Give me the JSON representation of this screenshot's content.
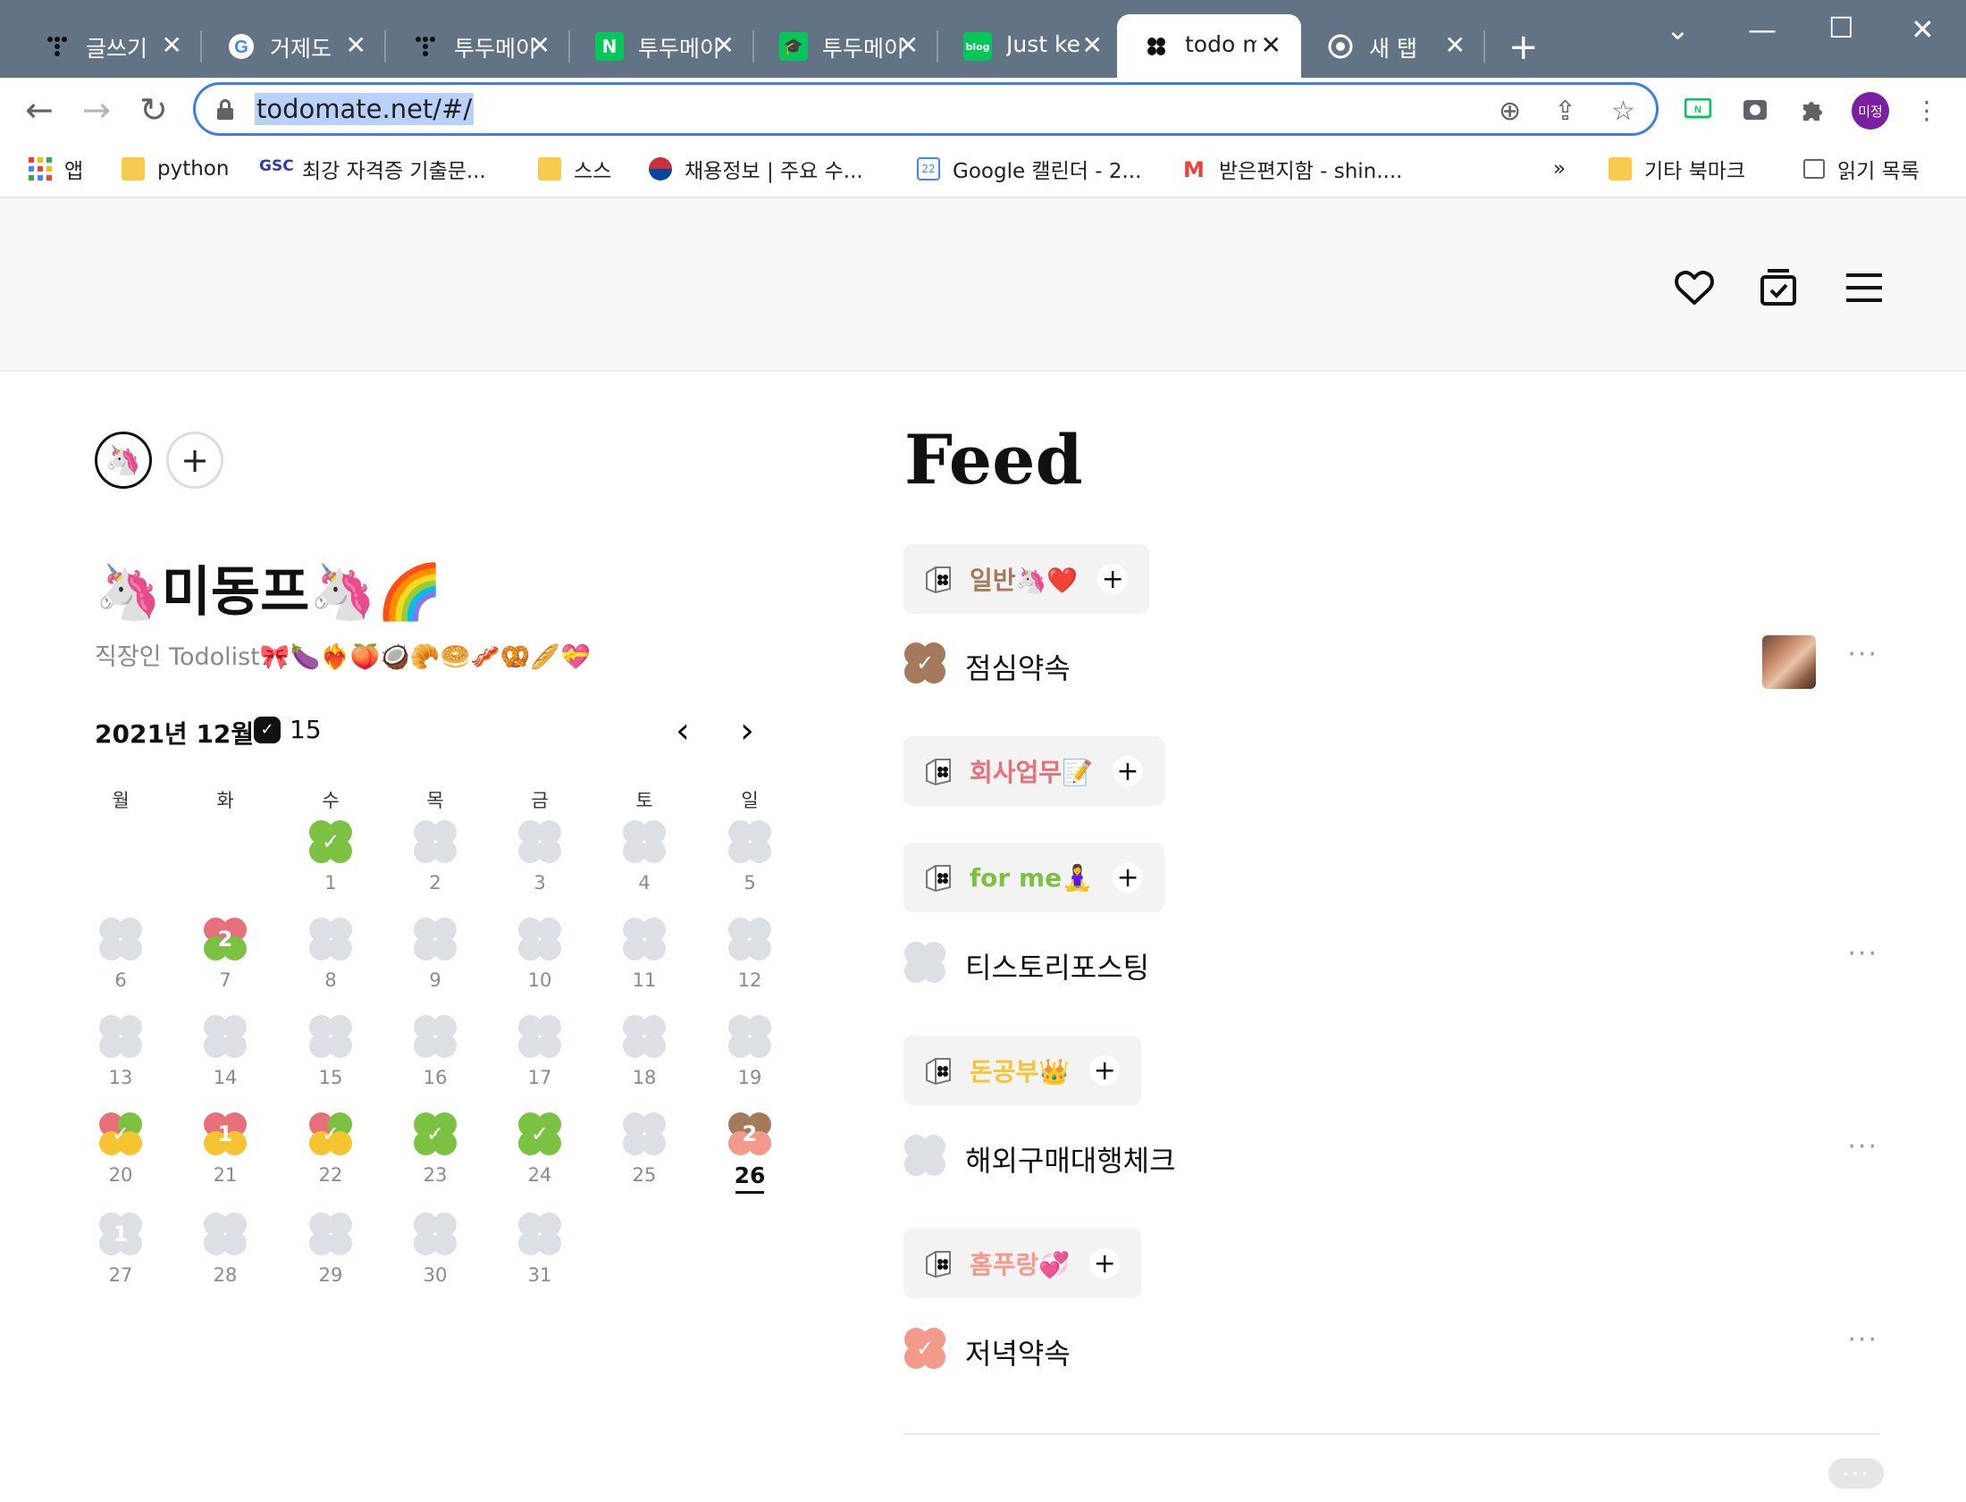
{
  "browser": {
    "tabs": [
      {
        "title": "글쓰기",
        "icon": "tistory-icon"
      },
      {
        "title": "거제도",
        "icon": "google-icon"
      },
      {
        "title": "투두메이",
        "icon": "tistory-icon"
      },
      {
        "title": "투두메이",
        "icon": "naver-icon"
      },
      {
        "title": "투두메이",
        "icon": "graduation-cap-icon"
      },
      {
        "title": "Just ke",
        "icon": "naver-blog-icon"
      },
      {
        "title": "todo m",
        "icon": "todomate-icon"
      },
      {
        "title": "새 탭",
        "icon": "chrome-icon"
      }
    ],
    "new_tab": "+",
    "url": "todomate.net/#/",
    "profile_label": "미정",
    "bookmarks": [
      {
        "label": "앱"
      },
      {
        "label": "python"
      },
      {
        "label": "최강 자격증 기출문..."
      },
      {
        "label": "스스"
      },
      {
        "label": "채용정보 | 주요 수..."
      },
      {
        "label": "Google 캘린더 - 2..."
      },
      {
        "label": "받은편지함 - shin...."
      }
    ],
    "bookmarks_overflow": "»",
    "other_bookmarks": "기타 북마크",
    "reading_list": "읽기 목록"
  },
  "profile": {
    "avatar": "🦄",
    "add": "+",
    "name": "🦄미동프🦄🌈",
    "description": "직장인 Todolist🎀🍆❤️‍🔥🍑🥥🥐🥯🥓🥨🥖💝"
  },
  "calendar": {
    "month_label": "2021년 12월",
    "check_count": "15",
    "prev": "‹",
    "next": "›",
    "weekdays": [
      "월",
      "화",
      "수",
      "목",
      "금",
      "토",
      "일"
    ],
    "days": [
      {
        "d": "1",
        "mark": "✓"
      },
      {
        "d": "2",
        "mark": ""
      },
      {
        "d": "3",
        "mark": ""
      },
      {
        "d": "4",
        "mark": ""
      },
      {
        "d": "5",
        "mark": ""
      },
      {
        "d": "6",
        "mark": ""
      },
      {
        "d": "7",
        "mark": "2"
      },
      {
        "d": "8",
        "mark": ""
      },
      {
        "d": "9",
        "mark": ""
      },
      {
        "d": "10",
        "mark": ""
      },
      {
        "d": "11",
        "mark": ""
      },
      {
        "d": "12",
        "mark": ""
      },
      {
        "d": "13",
        "mark": ""
      },
      {
        "d": "14",
        "mark": ""
      },
      {
        "d": "15",
        "mark": ""
      },
      {
        "d": "16",
        "mark": ""
      },
      {
        "d": "17",
        "mark": ""
      },
      {
        "d": "18",
        "mark": ""
      },
      {
        "d": "19",
        "mark": ""
      },
      {
        "d": "20",
        "mark": "✓"
      },
      {
        "d": "21",
        "mark": "1"
      },
      {
        "d": "22",
        "mark": "✓"
      },
      {
        "d": "23",
        "mark": "✓"
      },
      {
        "d": "24",
        "mark": "✓"
      },
      {
        "d": "25",
        "mark": ""
      },
      {
        "d": "26",
        "mark": "2"
      },
      {
        "d": "27",
        "mark": "1"
      },
      {
        "d": "28",
        "mark": ""
      },
      {
        "d": "29",
        "mark": ""
      },
      {
        "d": "30",
        "mark": ""
      },
      {
        "d": "31",
        "mark": ""
      }
    ]
  },
  "feed": {
    "title": "Feed",
    "categories": [
      {
        "name": "일반🦄❤️",
        "color": "#a57a5a",
        "plus": "+"
      },
      {
        "name": "회사업무📝",
        "color": "#e8707a",
        "plus": "+"
      },
      {
        "name": "for me🧘‍♀️",
        "color": "#7cc242",
        "plus": "+"
      },
      {
        "name": "돈공부👑",
        "color": "#f5c430",
        "plus": "+"
      },
      {
        "name": "홈푸랑💞",
        "color": "#f49a8a",
        "plus": "+"
      }
    ],
    "todos": [
      {
        "text": "점심약속",
        "done": true,
        "color": "#a57a5a"
      },
      {
        "text": "티스토리포스팅",
        "done": false,
        "color": "#dcdfe3"
      },
      {
        "text": "해외구매대행체크",
        "done": false,
        "color": "#dcdfe3"
      },
      {
        "text": "저녁약속",
        "done": true,
        "color": "#f49a8a"
      }
    ],
    "more": "···"
  },
  "colors": {
    "accent": "#3c7de6",
    "tab_strip": "#627386",
    "empty_blob": "#dcdfe3",
    "green": "#7cc242",
    "red": "#e8707a",
    "yellow": "#f5c430",
    "brown": "#a57a5a",
    "salmon": "#f49a8a"
  }
}
